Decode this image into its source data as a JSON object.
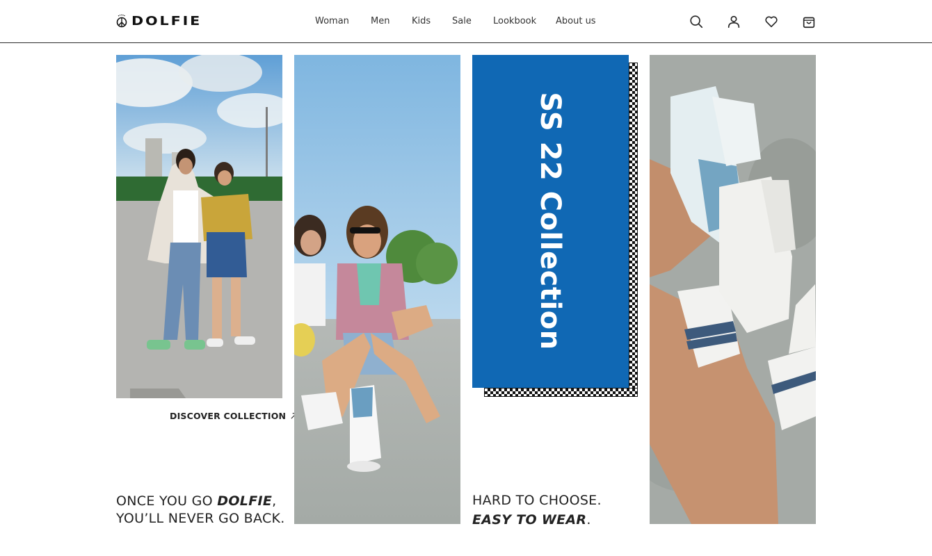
{
  "brand": {
    "name": "DOLFIE"
  },
  "nav": {
    "items": [
      {
        "label": "Woman"
      },
      {
        "label": "Men"
      },
      {
        "label": "Kids"
      },
      {
        "label": "Sale"
      },
      {
        "label": "Lookbook"
      },
      {
        "label": "About us"
      }
    ]
  },
  "header_icons": [
    "search-icon",
    "account-icon",
    "heart-icon",
    "bag-icon"
  ],
  "hero": {
    "discover_label": "DISCOVER COLLECTION",
    "slogan_1": {
      "pre": "ONCE YOU GO ",
      "brand": "DOLFIE",
      "post": ",",
      "line2": "YOU’LL NEVER GO BACK."
    },
    "collection_title": "SS 22 Collection",
    "slogan_2": {
      "line1": "HARD TO CHOOSE.",
      "emph": "EASY TO WEAR",
      "post": "."
    }
  },
  "colors": {
    "accent_blue": "#1068b4",
    "text": "#222222"
  }
}
